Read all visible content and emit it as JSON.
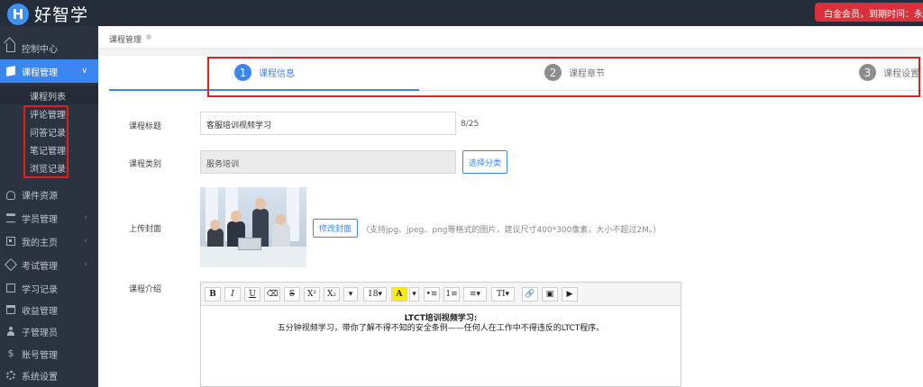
{
  "header": {
    "logo_mark": "H",
    "logo_text": "好智学",
    "vip_badge": "白金会员，到期时间：永久免"
  },
  "sidebar": {
    "items": [
      {
        "label": "控制中心",
        "icon": "home-icon"
      },
      {
        "label": "课程管理",
        "icon": "book-icon",
        "active": true,
        "arrow": "∨"
      },
      {
        "label": "课件资源",
        "icon": "cloud-icon"
      },
      {
        "label": "学员管理",
        "icon": "graduation-cap-icon",
        "arrow": "‹"
      },
      {
        "label": "我的主页",
        "icon": "grid-icon",
        "arrow": "‹"
      },
      {
        "label": "考试管理",
        "icon": "tag-icon",
        "arrow": "‹"
      },
      {
        "label": "学习记录",
        "icon": "document-icon"
      },
      {
        "label": "收益管理",
        "icon": "card-icon"
      },
      {
        "label": "子管理员",
        "icon": "person-icon"
      },
      {
        "label": "账号管理",
        "icon": "dollar-icon"
      },
      {
        "label": "系统设置",
        "icon": "gear-icon"
      }
    ],
    "submenu": [
      "课程列表",
      "评论管理",
      "问答记录",
      "笔记管理",
      "浏览记录"
    ]
  },
  "breadcrumb": "课程管理",
  "steps": [
    {
      "num": "1",
      "label": "课程信息",
      "state": "active"
    },
    {
      "num": "2",
      "label": "课程章节",
      "state": "pending"
    },
    {
      "num": "3",
      "label": "课程设置",
      "state": "pending"
    }
  ],
  "form": {
    "title_label": "课程标题",
    "title_value": "客服培训视频学习",
    "title_counter": "8/25",
    "category_label": "课程类别",
    "category_value": "服务培训",
    "choose_category_button": "选择分类",
    "cover_label": "上传封面",
    "change_cover_button": "修改封面",
    "cover_hint": "（支持jpg、jpeg、png等格式的图片，建议尺寸400*300像素，大小不超过2M。）",
    "intro_label": "课程介绍"
  },
  "editor": {
    "toolbar": [
      "B",
      "I",
      "U",
      "⌫",
      "S",
      "X²",
      "X₂",
      "▾",
      "18▾",
      "A",
      "▾",
      "•≡",
      "1≡",
      "≡▾",
      "TI▾",
      "🔗",
      "▣",
      "▶"
    ],
    "content_title": "LTCT培训视频学习:",
    "content_text": "五分钟视频学习，带你了解不得不知的安全条例——任何人在工作中不得违反的LTCT程序。"
  }
}
